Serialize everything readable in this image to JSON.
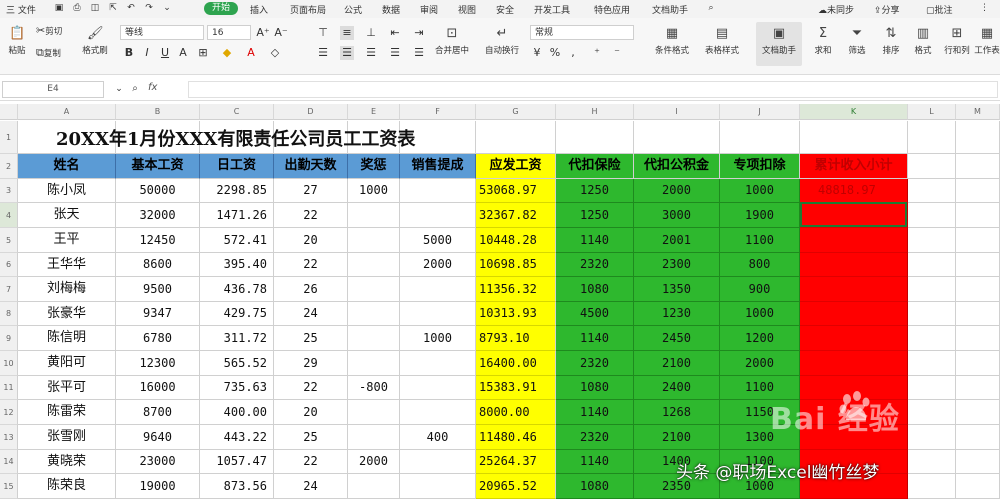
{
  "menu": {
    "file": "三 文件",
    "tabs": [
      "开始",
      "插入",
      "页面布局",
      "公式",
      "数据",
      "审阅",
      "视图",
      "安全",
      "开发工具",
      "特色应用",
      "文档助手"
    ],
    "sync": "未同步",
    "share": "分享",
    "batch": "批注"
  },
  "toolbar": {
    "paste_label": "粘贴",
    "cut_label": "剪切",
    "copy_label": "复制",
    "format_painter_label": "格式刷",
    "font_name": "等线",
    "font_size": "16",
    "merge_label": "合并居中",
    "wrap_label": "自动换行",
    "number_format": "常规",
    "cond_format_label": "条件格式",
    "table_style_label": "表格样式",
    "doc_helper_label": "文档助手",
    "sum_label": "求和",
    "filter_label": "筛选",
    "sort_label": "排序",
    "format_label": "格式",
    "rowcol_label": "行和列",
    "sheet_label": "工作表"
  },
  "formula_bar": {
    "name_box": "E4",
    "fx": "fx",
    "content": ""
  },
  "columns": [
    "A",
    "B",
    "C",
    "D",
    "E",
    "F",
    "G",
    "H",
    "I",
    "J",
    "K",
    "L",
    "M"
  ],
  "rows": [
    "1",
    "2",
    "3",
    "4",
    "5",
    "6",
    "7",
    "8",
    "9",
    "10",
    "11",
    "12",
    "13",
    "14",
    "15"
  ],
  "sheet": {
    "title": "20XX年1月份XXX有限责任公司员工工资表",
    "headers": [
      "姓名",
      "基本工资",
      "日工资",
      "出勤天数",
      "奖惩",
      "销售提成",
      "应发工资",
      "代扣保险",
      "代扣公积金",
      "专项扣除",
      "累计收入小计"
    ],
    "data": [
      [
        "陈小凤",
        "50000",
        "2298.85",
        "27",
        "1000",
        "",
        "53068.97",
        "1250",
        "2000",
        "1000",
        "48818.97"
      ],
      [
        "张天",
        "32000",
        "1471.26",
        "22",
        "",
        "",
        "32367.82",
        "1250",
        "3000",
        "1900",
        ""
      ],
      [
        "王平",
        "12450",
        "572.41",
        "20",
        "",
        "5000",
        "10448.28",
        "1140",
        "2001",
        "1100",
        ""
      ],
      [
        "王华华",
        "8600",
        "395.40",
        "22",
        "",
        "2000",
        "10698.85",
        "2320",
        "2300",
        "800",
        ""
      ],
      [
        "刘梅梅",
        "9500",
        "436.78",
        "26",
        "",
        "",
        "11356.32",
        "1080",
        "1350",
        "900",
        ""
      ],
      [
        "张豪华",
        "9347",
        "429.75",
        "24",
        "",
        "",
        "10313.93",
        "4500",
        "1230",
        "1000",
        ""
      ],
      [
        "陈信明",
        "6780",
        "311.72",
        "25",
        "",
        "1000",
        "8793.10",
        "1140",
        "2450",
        "1200",
        ""
      ],
      [
        "黄阳可",
        "12300",
        "565.52",
        "29",
        "",
        "",
        "16400.00",
        "2320",
        "2100",
        "2000",
        ""
      ],
      [
        "张平可",
        "16000",
        "735.63",
        "22",
        "-800",
        "",
        "15383.91",
        "1080",
        "2400",
        "1100",
        ""
      ],
      [
        "陈雷荣",
        "8700",
        "400.00",
        "20",
        "",
        "",
        "8000.00",
        "1140",
        "1268",
        "1150",
        ""
      ],
      [
        "张雪刚",
        "9640",
        "443.22",
        "25",
        "",
        "400",
        "11480.46",
        "2320",
        "2100",
        "1300",
        ""
      ],
      [
        "黄晓荣",
        "23000",
        "1057.47",
        "22",
        "2000",
        "",
        "25264.37",
        "1140",
        "1400",
        "1100",
        ""
      ],
      [
        "陈荣良",
        "19000",
        "873.56",
        "24",
        "",
        "",
        "20965.52",
        "1080",
        "2350",
        "1000",
        ""
      ]
    ]
  },
  "colors": {
    "header_blue": "#5b9bd5",
    "yellow": "#ffff00",
    "green": "#2eb82e",
    "red": "#ff0000",
    "accent_green": "#2ea44f"
  },
  "watermark": {
    "brand": "Bai 经验",
    "author": "头条 @职场Excel幽竹丝梦"
  }
}
